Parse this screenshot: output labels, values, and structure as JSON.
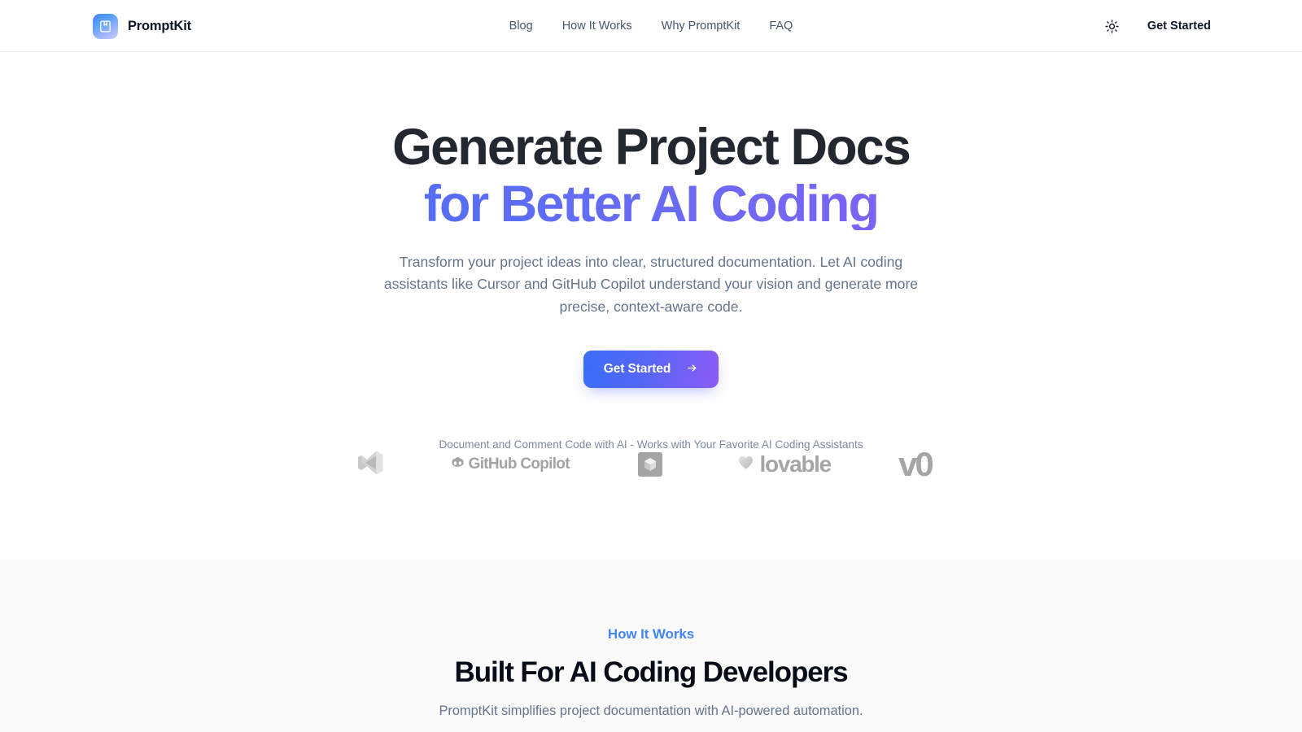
{
  "brand": {
    "name": "PromptKit",
    "logo_icon": "book-bookmark-icon",
    "logo_gradient_from": "#3b82f6",
    "logo_gradient_to": "#c7d2fe"
  },
  "header": {
    "nav_links": [
      {
        "label": "Blog",
        "name": "nav-link-blog"
      },
      {
        "label": "How It Works",
        "name": "nav-link-how-it-works"
      },
      {
        "label": "Why PromptKit",
        "name": "nav-link-why-promptkit"
      },
      {
        "label": "FAQ",
        "name": "nav-link-faq"
      }
    ],
    "theme_toggle_icon": "sun-icon",
    "cta_label": "Get Started"
  },
  "hero": {
    "headline_line1": "Generate Project Docs",
    "headline_line2": "for Better AI Coding",
    "headline_gradient_from": "#3b6ef6",
    "headline_gradient_to": "#8b5cf6",
    "subhead": "Transform your project ideas into clear, structured documentation. Let AI coding assistants like Cursor and GitHub Copilot understand your vision and generate more precise, context-aware code.",
    "button_label": "Get Started",
    "button_icon": "arrow-right-icon",
    "logos_caption": "Document and Comment Code with AI - Works with Your Favorite AI Coding Assistants",
    "logos": [
      {
        "name": "vscode",
        "icon": "vscode-logo-icon",
        "label": ""
      },
      {
        "name": "github-copilot",
        "icon": "github-copilot-logo-icon",
        "label": "GitHub Copilot"
      },
      {
        "name": "cursor",
        "icon": "cursor-logo-icon",
        "label": ""
      },
      {
        "name": "lovable",
        "icon": "lovable-logo-icon",
        "label": "lovable"
      },
      {
        "name": "v0",
        "icon": "v0-logo-icon",
        "label": "v0"
      }
    ]
  },
  "how_it_works": {
    "eyebrow": "How It Works",
    "eyebrow_color": "#4485f4",
    "title": "Built For AI Coding Developers",
    "subtitle": "PromptKit simplifies project documentation with AI-powered automation."
  }
}
